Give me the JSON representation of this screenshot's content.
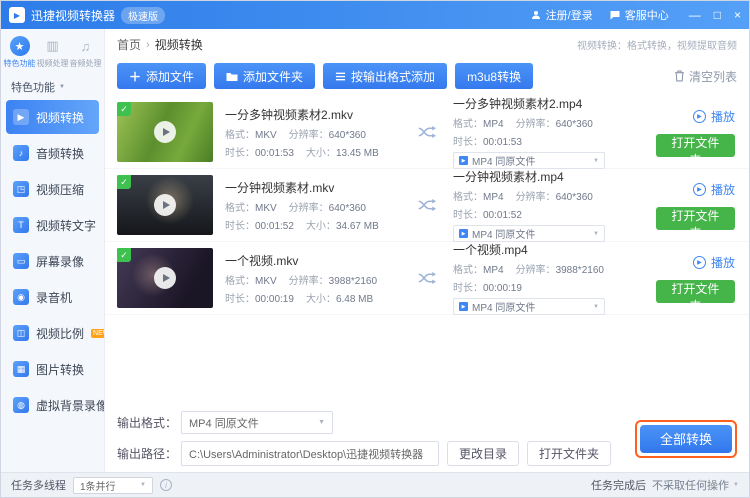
{
  "titlebar": {
    "title": "迅捷视频转换器",
    "badge": "极速版",
    "login": "注册/登录",
    "service": "客服中心"
  },
  "icons": {
    "app": "▶",
    "min": "—",
    "max": "□",
    "close": "×",
    "check": "✓",
    "plus": "＋",
    "caret_down": "▼",
    "breadcrumb_sep": "›",
    "play_glyph": "▶",
    "info": "i",
    "section_caret": "▼"
  },
  "sidebar": {
    "tabs": [
      {
        "label": "特色功能",
        "icon": "★"
      },
      {
        "label": "视频处理",
        "icon": "▥"
      },
      {
        "label": "音频处理",
        "icon": "♫"
      }
    ],
    "section": "特色功能",
    "items": [
      {
        "label": "视频转换",
        "icon": "▶"
      },
      {
        "label": "音频转换",
        "icon": "♪"
      },
      {
        "label": "视频压缩",
        "icon": "◳"
      },
      {
        "label": "视频转文字",
        "icon": "T"
      },
      {
        "label": "屏幕录像",
        "icon": "▭"
      },
      {
        "label": "录音机",
        "icon": "◉"
      },
      {
        "label": "视频比例",
        "icon": "◫",
        "badge": "NEW"
      },
      {
        "label": "图片转换",
        "icon": "▦"
      },
      {
        "label": "虚拟背景录像",
        "icon": "◍"
      }
    ]
  },
  "breadcrumb": {
    "home": "首页",
    "current": "视频转换"
  },
  "hint": "视频转换：格式转换，视频提取音频",
  "toolbar": {
    "add_file": "添加文件",
    "add_folder": "添加文件夹",
    "add_by_format": "按输出格式添加",
    "m3u8": "m3u8转换",
    "clear": "清空列表"
  },
  "labels": {
    "format": "格式：",
    "duration": "时长：",
    "resolution": "分辨率：",
    "size": "大小：",
    "play": "播放",
    "open_folder": "打开文件夹"
  },
  "files": [
    {
      "src_name": "一分多钟视频素材2.mkv",
      "src_format": "MKV",
      "src_resolution": "640*360",
      "src_duration": "00:01:53",
      "src_size": "13.45 MB",
      "dst_name": "一分多钟视频素材2.mp4",
      "dst_format": "MP4",
      "dst_resolution": "640*360",
      "dst_duration": "00:01:53",
      "preset": "MP4 同原文件"
    },
    {
      "src_name": "一分钟视频素材.mkv",
      "src_format": "MKV",
      "src_resolution": "640*360",
      "src_duration": "00:01:52",
      "src_size": "34.67 MB",
      "dst_name": "一分钟视频素材.mp4",
      "dst_format": "MP4",
      "dst_resolution": "640*360",
      "dst_duration": "00:01:52",
      "preset": "MP4 同原文件"
    },
    {
      "src_name": "一个视频.mkv",
      "src_format": "MKV",
      "src_resolution": "3988*2160",
      "src_duration": "00:00:19",
      "src_size": "6.48 MB",
      "dst_name": "一个视频.mp4",
      "dst_format": "MP4",
      "dst_resolution": "3988*2160",
      "dst_duration": "00:00:19",
      "preset": "MP4 同原文件"
    }
  ],
  "footer": {
    "output_format_label": "输出格式：",
    "output_format_value": "MP4 同原文件",
    "output_path_label": "输出路径：",
    "output_path_value": "C:\\Users\\Administrator\\Desktop\\迅捷视频转换器",
    "change_dir": "更改目录",
    "open_folder": "打开文件夹",
    "convert_all": "全部转换"
  },
  "statusbar": {
    "thread_label": "任务多线程",
    "thread_value": "1条并行",
    "after_label": "任务完成后",
    "after_value": "不采取任何操作"
  }
}
